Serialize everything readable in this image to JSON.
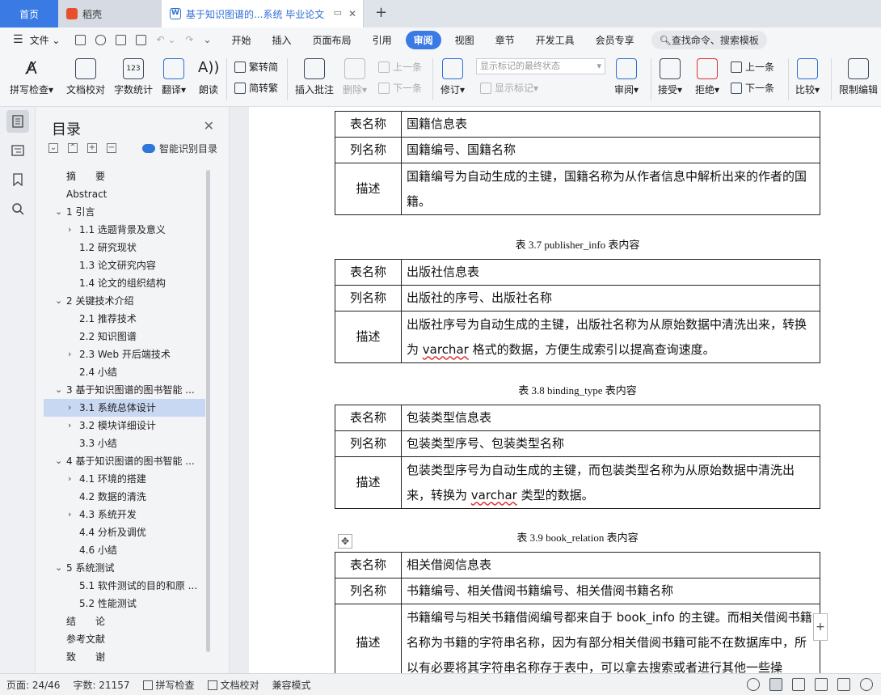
{
  "tabs": {
    "home": "首页",
    "doc1": "稻壳",
    "doc2": "基于知识图谱的...系统 毕业论文",
    "new": "+"
  },
  "menubar": {
    "file": "文件",
    "items": [
      "开始",
      "插入",
      "页面布局",
      "引用",
      "审阅",
      "视图",
      "章节",
      "开发工具",
      "会员专享"
    ],
    "active": "审阅",
    "search": "查找命令、搜索模板"
  },
  "ribbon": {
    "spell": "拼写检查",
    "doccheck": "文档校对",
    "wordcount": "字数统计",
    "translate": "翻译",
    "read": "朗读",
    "trad": "繁转简",
    "simp": "简转繁",
    "insert_comment": "插入批注",
    "delete": "删除",
    "prev_comment": "上一条",
    "next_comment": "下一条",
    "revise": "修订",
    "markup_state": "显示标记的最终状态",
    "show_markup": "显示标记",
    "review": "审阅",
    "accept": "接受",
    "reject": "拒绝",
    "prev": "上一条",
    "next": "下一条",
    "compare": "比较",
    "restrict": "限制编辑"
  },
  "toc": {
    "title": "目录",
    "smart": "智能识别目录",
    "items": [
      {
        "text": "摘　　要",
        "level": 0,
        "arrow": ""
      },
      {
        "text": "Abstract",
        "level": 0,
        "arrow": ""
      },
      {
        "text": "1  引言",
        "level": 0,
        "arrow": "v"
      },
      {
        "text": "1.1 选题背景及意义",
        "level": 1,
        "arrow": ">"
      },
      {
        "text": "1.2 研究现状",
        "level": 1,
        "arrow": ""
      },
      {
        "text": "1.3  论文研究内容",
        "level": 1,
        "arrow": ""
      },
      {
        "text": "1.4  论文的组织结构",
        "level": 1,
        "arrow": ""
      },
      {
        "text": "2  关键技术介绍",
        "level": 0,
        "arrow": "v"
      },
      {
        "text": "2.1 推荐技术",
        "level": 1,
        "arrow": ""
      },
      {
        "text": "2.2 知识图谱",
        "level": 1,
        "arrow": ""
      },
      {
        "text": "2.3 Web 开后端技术",
        "level": 1,
        "arrow": ">"
      },
      {
        "text": "2.4  小结",
        "level": 1,
        "arrow": ""
      },
      {
        "text": "3  基于知识图谱的图书智能 ...",
        "level": 0,
        "arrow": "v"
      },
      {
        "text": "3.1  系统总体设计",
        "level": 1,
        "arrow": ">"
      },
      {
        "text": "3.2  模块详细设计",
        "level": 1,
        "arrow": ">"
      },
      {
        "text": "3.3  小结",
        "level": 1,
        "arrow": ""
      },
      {
        "text": "4  基于知识图谱的图书智能 ...",
        "level": 0,
        "arrow": "v"
      },
      {
        "text": "4.1  环境的搭建",
        "level": 1,
        "arrow": ">"
      },
      {
        "text": "4.2  数据的清洗",
        "level": 1,
        "arrow": ""
      },
      {
        "text": "4.3  系统开发",
        "level": 1,
        "arrow": ">"
      },
      {
        "text": "4.4  分析及调优",
        "level": 1,
        "arrow": ""
      },
      {
        "text": "4.6  小结",
        "level": 1,
        "arrow": ""
      },
      {
        "text": "5  系统测试",
        "level": 0,
        "arrow": "v"
      },
      {
        "text": "5.1  软件测试的目的和原 ...",
        "level": 1,
        "arrow": ""
      },
      {
        "text": "5.2  性能测试",
        "level": 1,
        "arrow": ""
      },
      {
        "text": "结　　论",
        "level": 0,
        "arrow": ""
      },
      {
        "text": "参考文献",
        "level": 0,
        "arrow": ""
      },
      {
        "text": "致　　谢",
        "level": 0,
        "arrow": ""
      }
    ],
    "selected_index": 13
  },
  "document": {
    "label_table": "表名称",
    "label_cols": "列名称",
    "label_desc": "描述",
    "t1": {
      "name": "国籍信息表",
      "cols": "国籍编号、国籍名称",
      "desc": "国籍编号为自动生成的主键，国籍名称为从作者信息中解析出来的作者的国籍。"
    },
    "cap2": "表 3.7 publisher_info 表内容",
    "t2": {
      "name": "出版社信息表",
      "cols": "出版社的序号、出版社名称",
      "desc_a": "出版社序号为自动生成的主键，出版社名称为从原始数据中清洗出来，转换为 ",
      "desc_u": "varchar",
      "desc_b": " 格式的数据，方便生成索引以提高查询速度。"
    },
    "cap3": "表 3.8 binding_type 表内容",
    "t3": {
      "name": "包装类型信息表",
      "cols": "包装类型序号、包装类型名称",
      "desc_a": "包装类型序号为自动生成的主键，而包装类型名称为从原始数据中清洗出来，转换为 ",
      "desc_u": "varchar",
      "desc_b": " 类型的数据。"
    },
    "cap4": "表 3.9 book_relation 表内容",
    "t4": {
      "name": "相关借阅信息表",
      "cols": "书籍编号、相关借阅书籍编号、相关借阅书籍名称",
      "desc": "书籍编号与相关书籍借阅编号都来自于 book_info 的主键。而相关借阅书籍名称为书籍的字符串名称，因为有部分相关借阅书籍可能不在数据库中，所以有必要将其字符串名称存于表中，可以拿去搜索或者进行其他一些操"
    }
  },
  "status": {
    "page": "页面: 24/46",
    "words": "字数: 21157",
    "spell": "拼写检查",
    "doccheck": "文档校对",
    "compat": "兼容模式"
  },
  "colors": {
    "accent": "#3a7ae4",
    "selected_row": "#c8d7f2",
    "spell_underline": "#dd3333"
  }
}
